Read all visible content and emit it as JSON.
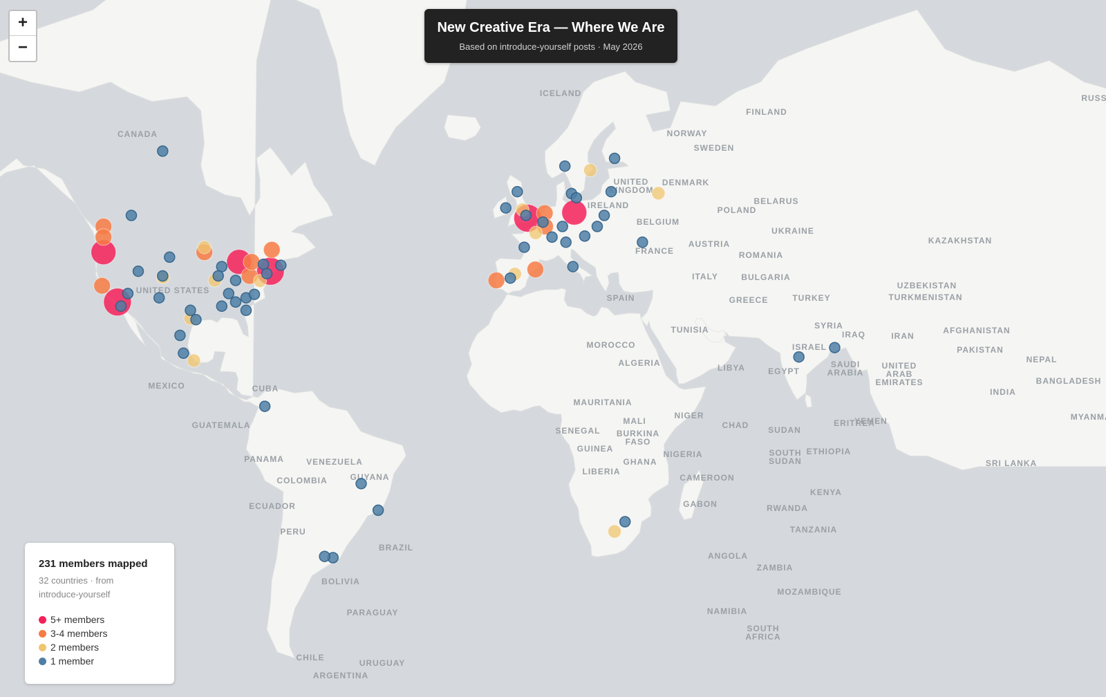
{
  "title": "New Creative Era — Where We Are",
  "subtitle": "Based on introduce-yourself posts · May 2026",
  "zoom": {
    "in": "+",
    "out": "−"
  },
  "legend": {
    "heading": "231 members mapped",
    "sub": "32 countries · from introduce-yourself",
    "items": [
      {
        "label": "5+ members",
        "color": "#f5215a"
      },
      {
        "label": "3-4 members",
        "color": "#f77b45"
      },
      {
        "label": "2 members",
        "color": "#f0c56f"
      },
      {
        "label": "1 member",
        "color": "#4f7fa6"
      }
    ]
  },
  "colors": {
    "ocean": "#d5d9dd",
    "land": "#f5f5f3",
    "c5": "#f5215a",
    "c3": "#f77b45",
    "c2": "#f0c56f",
    "c1": "#4f7fa6"
  },
  "place_labels": [
    "CANADA",
    "UNITED STATES",
    "MEXICO",
    "CUBA",
    "GUATEMALA",
    "PANAMA",
    "VENEZUELA",
    "COLOMBIA",
    "GUYANA",
    "ECUADOR",
    "PERU",
    "BRAZIL",
    "BOLIVIA",
    "PARAGUAY",
    "CHILE",
    "URUGUAY",
    "ARGENTINA",
    "ICELAND",
    "FINLAND",
    "NORWAY",
    "SWEDEN",
    "DENMARK",
    "UNITED KINGDOM",
    "IRELAND",
    "BELARUS",
    "POLAND",
    "UKRAINE",
    "BELGIUM",
    "FRANCE",
    "AUSTRIA",
    "ROMANIA",
    "ITALY",
    "BULGARIA",
    "SPAIN",
    "GREECE",
    "TURKEY",
    "KAZAKHSTAN",
    "UZBEKISTAN",
    "TURKMENISTAN",
    "SYRIA",
    "IRAQ",
    "IRAN",
    "AFGHANISTAN",
    "PAKISTAN",
    "NEPAL",
    "ISRAEL",
    "TUNISIA",
    "MOROCCO",
    "ALGERIA",
    "LIBYA",
    "EGYPT",
    "SAUDI ARABIA",
    "UNITED ARAB EMIRATES",
    "INDIA",
    "BANGLADESH",
    "MYANMAR",
    "MAURITANIA",
    "MALI",
    "NIGER",
    "CHAD",
    "SUDAN",
    "ERITREA",
    "YEMEN",
    "SENEGAL",
    "GUINEA",
    "BURKINA FASO",
    "NIGERIA",
    "GHANA",
    "ETHIOPIA",
    "SOUTH SUDAN",
    "LIBERIA",
    "CAMEROON",
    "KENYA",
    "GABON",
    "RWANDA",
    "TANZANIA",
    "ANGOLA",
    "ZAMBIA",
    "MOZAMBIQUE",
    "NAMIBIA",
    "SOUTH AFRICA",
    "SRI LANKA",
    "RUSSIA"
  ],
  "markers": [
    {
      "lat": 62,
      "lon": -105,
      "size": 1
    },
    {
      "lat": 50,
      "lon": -122,
      "size": 3
    },
    {
      "lat": 48,
      "lon": -122,
      "size": 3
    },
    {
      "lat": 45,
      "lon": -122,
      "size": 5
    },
    {
      "lat": 37.8,
      "lon": -122.4,
      "size": 3
    },
    {
      "lat": 34,
      "lon": -118,
      "size": 5
    },
    {
      "lat": 33,
      "lon": -117,
      "size": 1
    },
    {
      "lat": 52,
      "lon": -114,
      "size": 1
    },
    {
      "lat": 44,
      "lon": -103,
      "size": 1
    },
    {
      "lat": 40,
      "lon": -105,
      "size": 1
    },
    {
      "lat": 39.7,
      "lon": -104.9,
      "size": 2
    },
    {
      "lat": 41,
      "lon": -112,
      "size": 1
    },
    {
      "lat": 36,
      "lon": -115,
      "size": 1
    },
    {
      "lat": 35,
      "lon": -106,
      "size": 1
    },
    {
      "lat": 32,
      "lon": -97,
      "size": 1
    },
    {
      "lat": 30,
      "lon": -97,
      "size": 2
    },
    {
      "lat": 29.7,
      "lon": -95.4,
      "size": 1
    },
    {
      "lat": 25.7,
      "lon": -100,
      "size": 1
    },
    {
      "lat": 21,
      "lon": -99,
      "size": 1
    },
    {
      "lat": 19,
      "lon": -96,
      "size": 2
    },
    {
      "lat": 46,
      "lon": -93,
      "size": 2
    },
    {
      "lat": 45,
      "lon": -93,
      "size": 3
    },
    {
      "lat": 42,
      "lon": -88,
      "size": 1
    },
    {
      "lat": 40,
      "lon": -89,
      "size": 1
    },
    {
      "lat": 39,
      "lon": -84,
      "size": 1
    },
    {
      "lat": 43,
      "lon": -83,
      "size": 5
    },
    {
      "lat": 39,
      "lon": -90,
      "size": 2
    },
    {
      "lat": 36,
      "lon": -86,
      "size": 1
    },
    {
      "lat": 34,
      "lon": -84,
      "size": 1
    },
    {
      "lat": 33,
      "lon": -88,
      "size": 1
    },
    {
      "lat": 35,
      "lon": -81,
      "size": 1
    },
    {
      "lat": 40,
      "lon": -80,
      "size": 3
    },
    {
      "lat": 43,
      "lon": -79.4,
      "size": 3
    },
    {
      "lat": 45.5,
      "lon": -73.6,
      "size": 3
    },
    {
      "lat": 42.5,
      "lon": -76,
      "size": 1
    },
    {
      "lat": 41,
      "lon": -74,
      "size": 5
    },
    {
      "lat": 42.3,
      "lon": -71,
      "size": 1
    },
    {
      "lat": 40.5,
      "lon": -75,
      "size": 1
    },
    {
      "lat": 38.9,
      "lon": -77,
      "size": 2
    },
    {
      "lat": 35.8,
      "lon": -78.6,
      "size": 1
    },
    {
      "lat": 32,
      "lon": -81,
      "size": 1
    },
    {
      "lat": 6.2,
      "lon": -75.6,
      "size": 1
    },
    {
      "lat": -15.8,
      "lon": -47.9,
      "size": 1
    },
    {
      "lat": -23,
      "lon": -43,
      "size": 1
    },
    {
      "lat": -34.9,
      "lon": -56,
      "size": 1
    },
    {
      "lat": -34.6,
      "lon": -58.4,
      "size": 1
    },
    {
      "lat": 61,
      "lon": 25,
      "size": 1
    },
    {
      "lat": 59.9,
      "lon": 10.7,
      "size": 1
    },
    {
      "lat": 59.3,
      "lon": 18,
      "size": 2
    },
    {
      "lat": 55.7,
      "lon": 12.6,
      "size": 1
    },
    {
      "lat": 55,
      "lon": 14,
      "size": 1
    },
    {
      "lat": 56,
      "lon": -3,
      "size": 1
    },
    {
      "lat": 53,
      "lon": -1.5,
      "size": 2
    },
    {
      "lat": 52,
      "lon": -0.5,
      "size": 1
    },
    {
      "lat": 53.3,
      "lon": -6.3,
      "size": 1
    },
    {
      "lat": 51.5,
      "lon": 0,
      "size": 5
    },
    {
      "lat": 52.4,
      "lon": 4.9,
      "size": 3
    },
    {
      "lat": 50.8,
      "lon": 4.4,
      "size": 1
    },
    {
      "lat": 50,
      "lon": 5,
      "size": 3
    },
    {
      "lat": 52.5,
      "lon": 13.4,
      "size": 5
    },
    {
      "lat": 50,
      "lon": 10,
      "size": 1
    },
    {
      "lat": 48,
      "lon": 7,
      "size": 1
    },
    {
      "lat": 48.2,
      "lon": 16.4,
      "size": 1
    },
    {
      "lat": 47,
      "lon": 11,
      "size": 1
    },
    {
      "lat": 50,
      "lon": 20,
      "size": 1
    },
    {
      "lat": 52,
      "lon": 22,
      "size": 1
    },
    {
      "lat": 55.75,
      "lon": 37.6,
      "size": 2
    },
    {
      "lat": 56,
      "lon": 24,
      "size": 1
    },
    {
      "lat": 47,
      "lon": 33,
      "size": 1
    },
    {
      "lat": 48.8,
      "lon": 2.3,
      "size": 2
    },
    {
      "lat": 46,
      "lon": -1,
      "size": 1
    },
    {
      "lat": 42,
      "lon": 13,
      "size": 1
    },
    {
      "lat": 41.4,
      "lon": 2.2,
      "size": 3
    },
    {
      "lat": 40.4,
      "lon": -3.7,
      "size": 2
    },
    {
      "lat": 39.5,
      "lon": -5,
      "size": 1
    },
    {
      "lat": 39,
      "lon": -9,
      "size": 3
    },
    {
      "lat": 20,
      "lon": 78,
      "size": 1
    },
    {
      "lat": 22.5,
      "lon": 88.3,
      "size": 1
    },
    {
      "lat": -26,
      "lon": 28,
      "size": 1
    },
    {
      "lat": -28.5,
      "lon": 25,
      "size": 2
    }
  ]
}
